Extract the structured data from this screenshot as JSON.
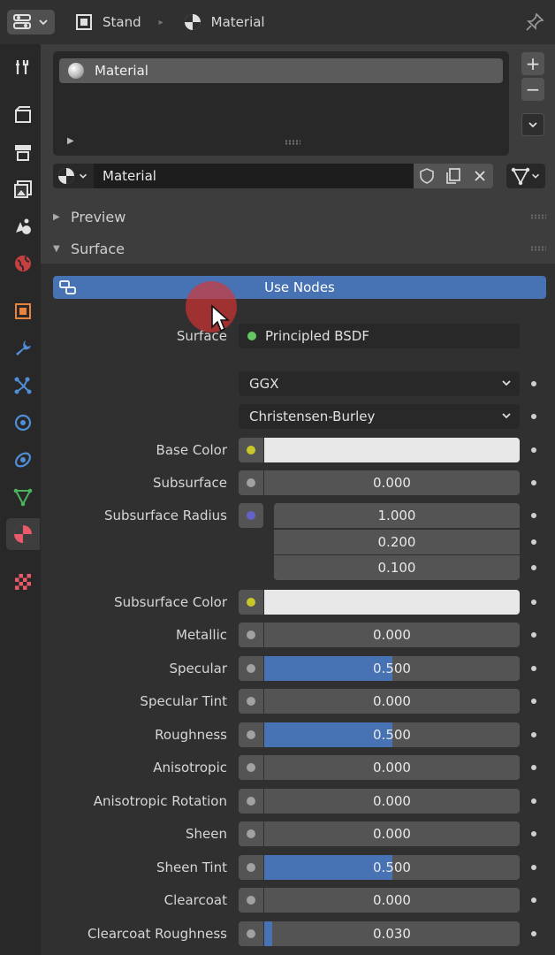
{
  "header": {
    "object_name": "Stand",
    "material_name": "Material"
  },
  "slots": {
    "items": [
      {
        "label": "Material"
      }
    ]
  },
  "datablock": {
    "name": "Material"
  },
  "panels": {
    "preview": "Preview",
    "surface": "Surface"
  },
  "use_nodes_label": "Use Nodes",
  "surface_row": {
    "label": "Surface",
    "value": "Principled BSDF"
  },
  "distribution": "GGX",
  "subsurface_method": "Christensen-Burley",
  "properties": [
    {
      "label": "Base Color",
      "kind": "color",
      "socket_color": "#c7c729"
    },
    {
      "label": "Subsurface",
      "kind": "value",
      "value": "0.000",
      "fraction": 0.0,
      "socket_color": "#a1a1a1"
    },
    {
      "label": "Subsurface Radius",
      "kind": "vector",
      "values": [
        "1.000",
        "0.200",
        "0.100"
      ],
      "socket_color": "#6363c7"
    },
    {
      "label": "Subsurface Color",
      "kind": "color",
      "socket_color": "#c7c729"
    },
    {
      "label": "Metallic",
      "kind": "value",
      "value": "0.000",
      "fraction": 0.0,
      "socket_color": "#a1a1a1"
    },
    {
      "label": "Specular",
      "kind": "value",
      "value": "0.500",
      "fraction": 0.5,
      "socket_color": "#a1a1a1"
    },
    {
      "label": "Specular Tint",
      "kind": "value",
      "value": "0.000",
      "fraction": 0.0,
      "socket_color": "#a1a1a1"
    },
    {
      "label": "Roughness",
      "kind": "value",
      "value": "0.500",
      "fraction": 0.5,
      "socket_color": "#a1a1a1"
    },
    {
      "label": "Anisotropic",
      "kind": "value",
      "value": "0.000",
      "fraction": 0.0,
      "socket_color": "#a1a1a1"
    },
    {
      "label": "Anisotropic Rotation",
      "kind": "value",
      "value": "0.000",
      "fraction": 0.0,
      "socket_color": "#a1a1a1"
    },
    {
      "label": "Sheen",
      "kind": "value",
      "value": "0.000",
      "fraction": 0.0,
      "socket_color": "#a1a1a1"
    },
    {
      "label": "Sheen Tint",
      "kind": "value",
      "value": "0.500",
      "fraction": 0.5,
      "socket_color": "#a1a1a1"
    },
    {
      "label": "Clearcoat",
      "kind": "value",
      "value": "0.000",
      "fraction": 0.0,
      "socket_color": "#a1a1a1"
    },
    {
      "label": "Clearcoat Roughness",
      "kind": "value",
      "value": "0.030",
      "fraction": 0.03,
      "socket_color": "#a1a1a1"
    }
  ],
  "colors": {
    "accent": "#4772b3",
    "panel_bg": "#3d3d3d",
    "tab_bg": "#282828",
    "field_bg": "#545454"
  }
}
